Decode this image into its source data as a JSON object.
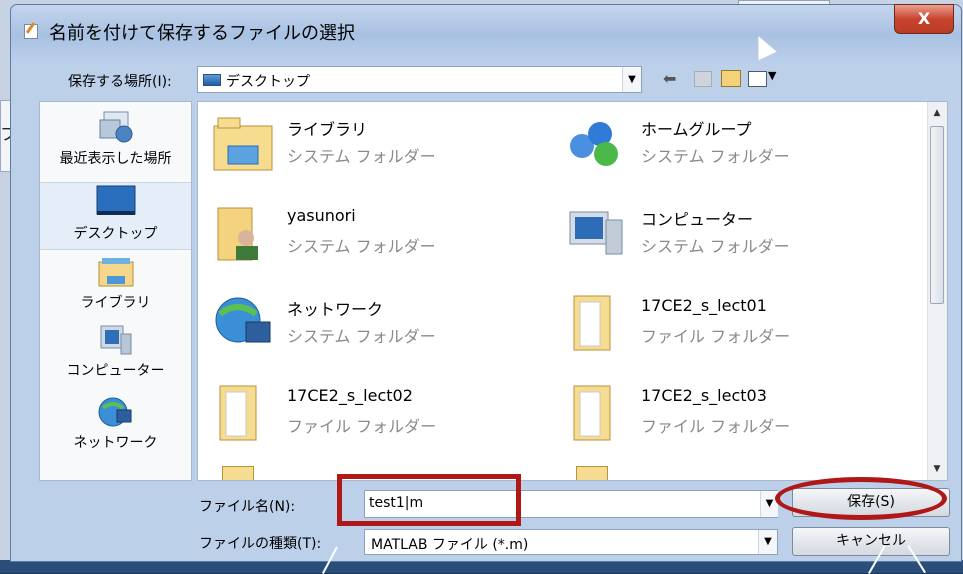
{
  "background": {
    "left_fragment_text": "ファ"
  },
  "dialog": {
    "title": "名前を付けて保存するファイルの選択",
    "close_label": "X",
    "save_in_label": "保存する場所(I):",
    "save_in_value": "デスクトップ",
    "toolbar_icons": [
      "back-icon",
      "up-folder-icon",
      "new-folder-icon",
      "view-menu-icon"
    ]
  },
  "places": [
    {
      "label": "最近表示した場所",
      "icon": "recent-places-icon"
    },
    {
      "label": "デスクトップ",
      "icon": "desktop-icon",
      "selected": true
    },
    {
      "label": "ライブラリ",
      "icon": "libraries-icon"
    },
    {
      "label": "コンピューター",
      "icon": "computer-icon"
    },
    {
      "label": "ネットワーク",
      "icon": "network-icon"
    }
  ],
  "files": [
    {
      "name": "ライブラリ",
      "type": "システム フォルダー",
      "icon": "libraries-folder-icon"
    },
    {
      "name": "ホームグループ",
      "type": "システム フォルダー",
      "icon": "homegroup-icon"
    },
    {
      "name": "yasunori",
      "type": "システム フォルダー",
      "icon": "user-folder-icon"
    },
    {
      "name": "コンピューター",
      "type": "システム フォルダー",
      "icon": "computer-icon"
    },
    {
      "name": "ネットワーク",
      "type": "システム フォルダー",
      "icon": "network-icon"
    },
    {
      "name": "17CE2_s_lect01",
      "type": "ファイル フォルダー",
      "icon": "folder-icon"
    },
    {
      "name": "17CE2_s_lect02",
      "type": "ファイル フォルダー",
      "icon": "folder-icon"
    },
    {
      "name": "17CE2_s_lect03",
      "type": "ファイル フォルダー",
      "icon": "folder-icon"
    }
  ],
  "form": {
    "filename_label": "ファイル名(N):",
    "filename_value": "test1|m",
    "filetype_label": "ファイルの種類(T):",
    "filetype_value": "MATLAB ファイル (*.m)",
    "save_button": "保存(S)",
    "cancel_button": "キャンセル"
  },
  "colors": {
    "annotation": "#b01818",
    "accent": "#1f5ea9"
  }
}
